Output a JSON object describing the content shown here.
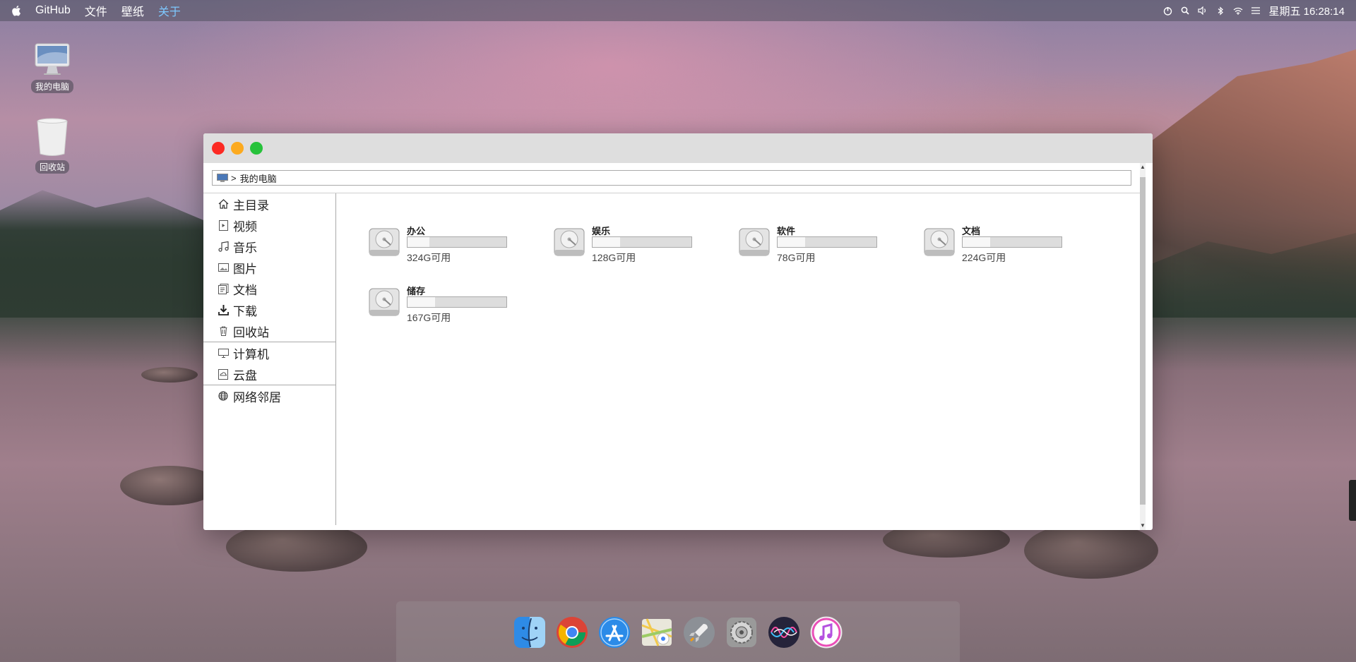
{
  "menubar": {
    "apple": "",
    "items": [
      "GitHub",
      "文件",
      "壁纸",
      "关于"
    ],
    "active_item": "关于",
    "clock": "星期五 16:28:14",
    "status_icons": [
      "power-icon",
      "search-icon",
      "volume-icon",
      "bluetooth-icon",
      "wifi-icon",
      "list-icon"
    ]
  },
  "desktop": {
    "icons": [
      {
        "label": "我的电脑",
        "icon": "imac-icon"
      },
      {
        "label": "回收站",
        "icon": "trash-icon"
      }
    ]
  },
  "window": {
    "address": {
      "separator": ">",
      "path": "我的电脑"
    },
    "sidebar": {
      "group1": [
        {
          "label": "主目录",
          "icon": "home-icon"
        },
        {
          "label": "视频",
          "icon": "video-icon"
        },
        {
          "label": "音乐",
          "icon": "music-icon"
        },
        {
          "label": "图片",
          "icon": "image-icon"
        },
        {
          "label": "文档",
          "icon": "document-icon"
        },
        {
          "label": "下载",
          "icon": "download-icon"
        },
        {
          "label": "回收站",
          "icon": "trash-icon"
        }
      ],
      "group2": [
        {
          "label": "计算机",
          "icon": "monitor-icon"
        },
        {
          "label": "云盘",
          "icon": "cloud-disk-icon"
        }
      ],
      "group3": [
        {
          "label": "网络邻居",
          "icon": "network-icon"
        }
      ]
    },
    "drives": [
      {
        "name": "办公",
        "free": "324G可用",
        "used_fraction": 0.22
      },
      {
        "name": "娱乐",
        "free": "128G可用",
        "used_fraction": 0.28
      },
      {
        "name": "软件",
        "free": "78G可用",
        "used_fraction": 0.28
      },
      {
        "name": "文档",
        "free": "224G可用",
        "used_fraction": 0.28
      },
      {
        "name": "储存",
        "free": "167G可用",
        "used_fraction": 0.28
      }
    ]
  },
  "dock": {
    "apps": [
      "finder-icon",
      "chrome-icon",
      "app-store-icon",
      "maps-icon",
      "launchpad-icon",
      "system-preferences-icon",
      "siri-icon",
      "itunes-icon"
    ]
  }
}
